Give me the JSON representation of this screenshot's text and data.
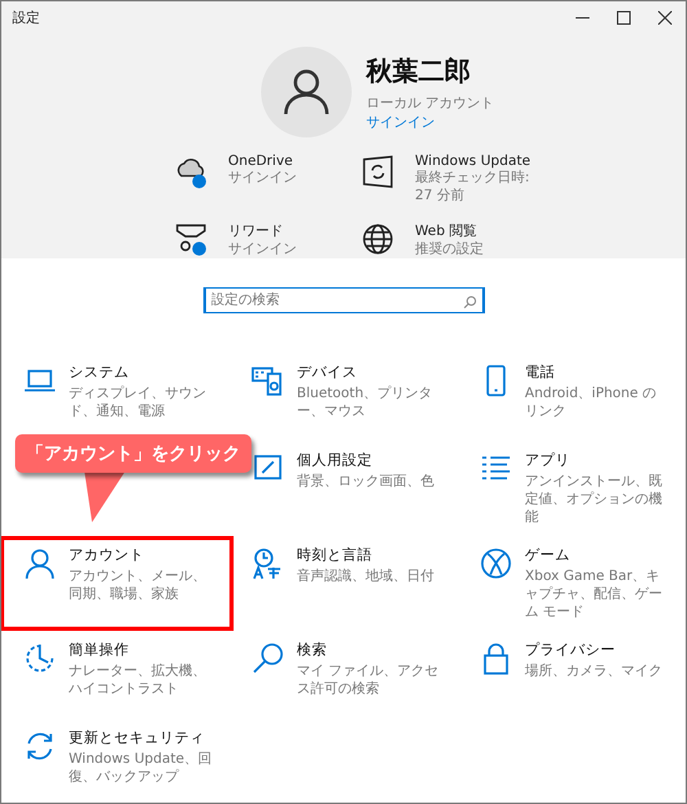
{
  "window": {
    "title": "設定"
  },
  "account": {
    "name": "秋葉二郎",
    "type": "ローカル アカウント",
    "link": "サインイン"
  },
  "quick_links": [
    {
      "title": "OneDrive",
      "subtitle": "サインイン"
    },
    {
      "title": "Windows Update",
      "subtitle": "最終チェック日時: 27 分前"
    },
    {
      "title": "リワード",
      "subtitle": "サインイン"
    },
    {
      "title": "Web 閲覧",
      "subtitle": "推奨の設定"
    }
  ],
  "search": {
    "placeholder": "設定の検索"
  },
  "categories": [
    {
      "title": "システム",
      "subtitle": "ディスプレイ、サウンド、通知、電源",
      "highlighted": false
    },
    {
      "title": "デバイス",
      "subtitle": "Bluetooth、プリンター、マウス",
      "highlighted": false
    },
    {
      "title": "電話",
      "subtitle": "Android、iPhone のリンク",
      "highlighted": false
    },
    {
      "title": "個人用設定",
      "subtitle": "背景、ロック画面、色",
      "highlighted": false
    },
    {
      "title": "アプリ",
      "subtitle": "アンインストール、既定値、オプションの機能",
      "highlighted": false
    },
    {
      "title": "アカウント",
      "subtitle": "アカウント、メール、同期、職場、家族",
      "highlighted": true
    },
    {
      "title": "時刻と言語",
      "subtitle": "音声認識、地域、日付",
      "highlighted": false
    },
    {
      "title": "ゲーム",
      "subtitle": "Xbox Game Bar、キャプチャ、配信、ゲーム モード",
      "highlighted": false
    },
    {
      "title": "簡単操作",
      "subtitle": "ナレーター、拡大機、ハイコントラスト",
      "highlighted": false
    },
    {
      "title": "検索",
      "subtitle": "マイ ファイル、アクセス許可の検索",
      "highlighted": false
    },
    {
      "title": "プライバシー",
      "subtitle": "場所、カメラ、マイク",
      "highlighted": false
    },
    {
      "title": "更新とセキュリティ",
      "subtitle": "Windows Update、回復、バックアップ",
      "highlighted": false
    }
  ],
  "callout": {
    "text": "「アカウント」をクリック"
  }
}
